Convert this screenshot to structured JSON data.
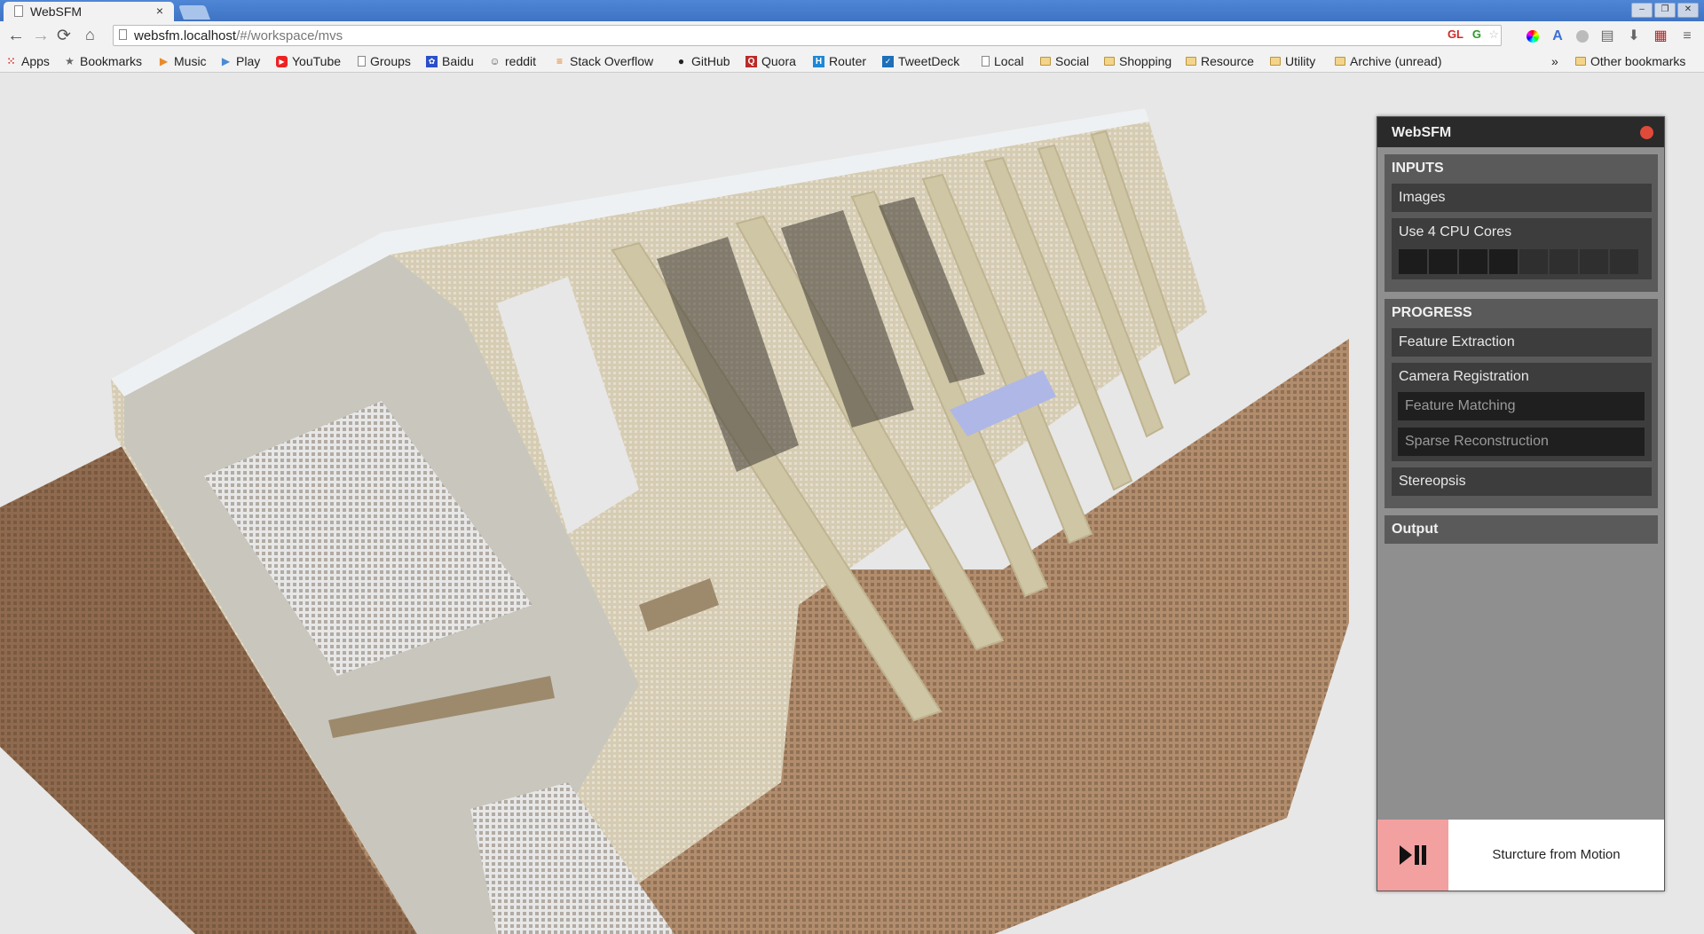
{
  "browser": {
    "tab_title": "WebSFM",
    "tab_close": "×",
    "url_host": "websfm.localhost",
    "url_path": "/#/workspace/mvs",
    "ext_gl": "GL"
  },
  "bookmarks": [
    {
      "label": "Apps",
      "icon": "apps-grid-icon"
    },
    {
      "label": "Bookmarks",
      "icon": "star-icon"
    },
    {
      "label": "Music",
      "icon": "play-store-icon"
    },
    {
      "label": "Play",
      "icon": "play-store-icon"
    },
    {
      "label": "YouTube",
      "icon": "youtube-icon"
    },
    {
      "label": "Groups",
      "icon": "page-icon"
    },
    {
      "label": "Baidu",
      "icon": "baidu-icon"
    },
    {
      "label": "reddit",
      "icon": "reddit-icon"
    },
    {
      "label": "Stack Overflow",
      "icon": "stackoverflow-icon"
    },
    {
      "label": "GitHub",
      "icon": "github-icon"
    },
    {
      "label": "Quora",
      "icon": "quora-icon"
    },
    {
      "label": "Router",
      "icon": "router-icon"
    },
    {
      "label": "TweetDeck",
      "icon": "tweetdeck-icon"
    },
    {
      "label": "Local",
      "icon": "page-icon"
    },
    {
      "label": "Social",
      "icon": "folder-icon"
    },
    {
      "label": "Shopping",
      "icon": "folder-icon"
    },
    {
      "label": "Resource",
      "icon": "folder-icon"
    },
    {
      "label": "Utility",
      "icon": "folder-icon"
    },
    {
      "label": "Archive (unread)",
      "icon": "folder-icon"
    }
  ],
  "bookmarks_overflow": "»",
  "other_bookmarks": "Other bookmarks",
  "panel": {
    "title": "WebSFM",
    "inputs": {
      "title": "INPUTS",
      "images": "Images",
      "cores_label": "Use 4 CPU Cores",
      "cores_total": 8,
      "cores_used": 4
    },
    "progress": {
      "title": "PROGRESS",
      "feature_extraction": "Feature Extraction",
      "camera_registration": "Camera Registration",
      "feature_matching": "Feature Matching",
      "sparse_reconstruction": "Sparse Reconstruction",
      "stereopsis": "Stereopsis"
    },
    "output": "Output",
    "footer_label": "Sturcture from Motion"
  },
  "colors": {
    "accent_red": "#e04a3a",
    "play_bg": "#f3a0a0",
    "panel_bg": "#8f8f8f",
    "section_bg": "#5a5a5a",
    "item_bg": "#3d3d3d"
  }
}
